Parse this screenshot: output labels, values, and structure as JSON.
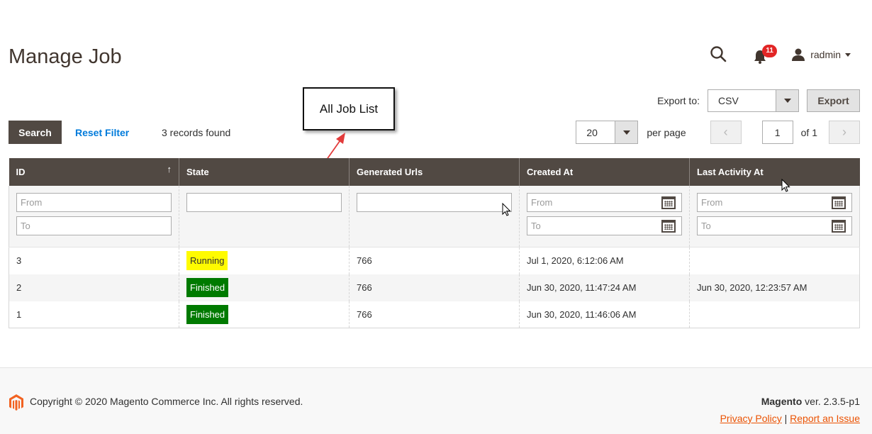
{
  "page": {
    "title": "Manage Job"
  },
  "header": {
    "notification_count": "11",
    "user_name": "radmin"
  },
  "annotation": {
    "label": "All Job List"
  },
  "export": {
    "label": "Export to:",
    "format": "CSV",
    "button": "Export"
  },
  "toolbar": {
    "search_label": "Search",
    "reset_label": "Reset Filter",
    "records_found": "3 records found"
  },
  "pager": {
    "per_page_value": "20",
    "per_page_label": "per page",
    "current_page": "1",
    "of_label": "of 1",
    "prev": "‹",
    "next": "›"
  },
  "grid": {
    "columns": [
      "ID",
      "State",
      "Generated Urls",
      "Created At",
      "Last Activity At"
    ],
    "sort_indicator": "↑",
    "filters": {
      "from": "From",
      "to": "To"
    },
    "rows": [
      {
        "id": "3",
        "state": "Running",
        "urls": "766",
        "created": "Jul 1, 2020, 6:12:06 AM",
        "last": ""
      },
      {
        "id": "2",
        "state": "Finished",
        "urls": "766",
        "created": "Jun 30, 2020, 11:47:24 AM",
        "last": "Jun 30, 2020, 12:23:57 AM"
      },
      {
        "id": "1",
        "state": "Finished",
        "urls": "766",
        "created": "Jun 30, 2020, 11:46:06 AM",
        "last": ""
      }
    ]
  },
  "footer": {
    "copyright": "Copyright © 2020 Magento Commerce Inc. All rights reserved.",
    "brand": "Magento",
    "version": " ver. 2.3.5-p1",
    "privacy": "Privacy Policy",
    "separator": " | ",
    "report": "Report an Issue"
  },
  "colors": {
    "header_bg": "#514943",
    "link": "#007bdb",
    "running": "#fffb00",
    "finished": "#007a00",
    "footer_link": "#eb5202",
    "badge": "#e22626"
  },
  "icons": [
    "search-icon",
    "bell-icon",
    "user-icon",
    "calendar-icon",
    "magento-logo-icon",
    "arrow-pointer"
  ]
}
